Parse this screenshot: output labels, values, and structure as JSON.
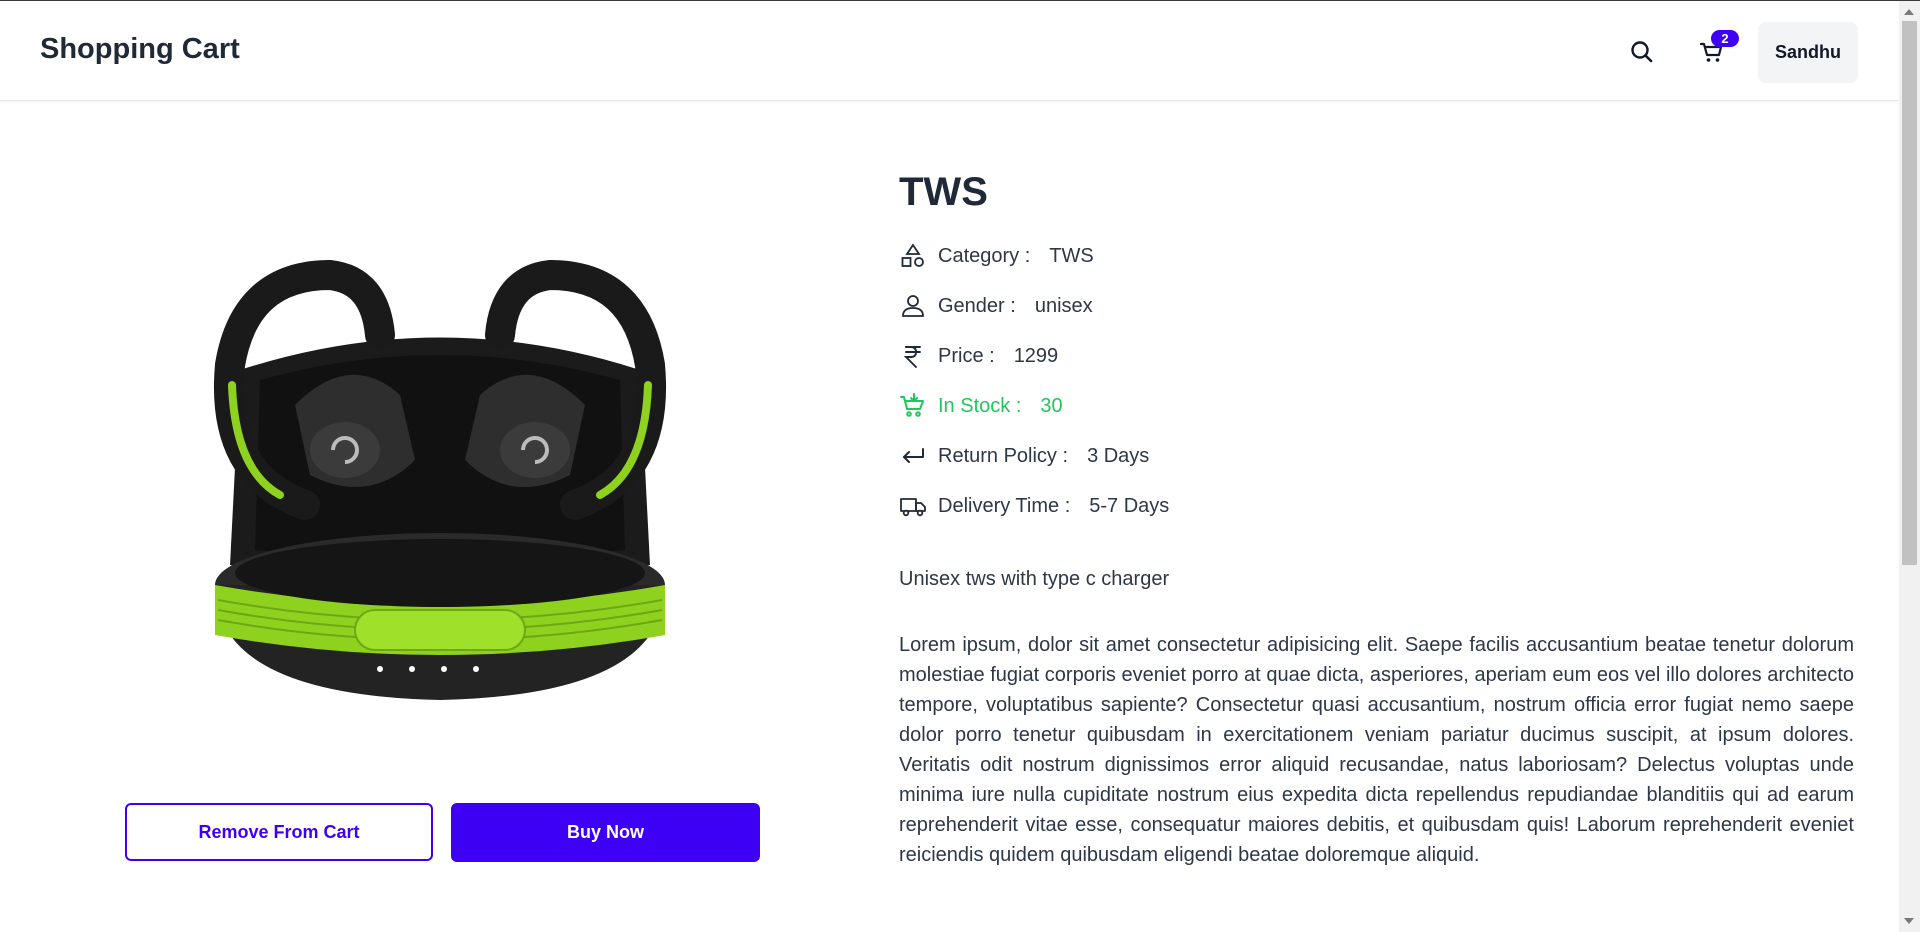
{
  "header": {
    "brand": "Shopping Cart",
    "cart_count": "2",
    "user_name": "Sandhu"
  },
  "product": {
    "name": "TWS",
    "image_icon": "wireless-earbuds-product-image",
    "specs": [
      {
        "label": "Category :",
        "value": "TWS",
        "icon": "shapes-icon"
      },
      {
        "label": "Gender :",
        "value": "unisex",
        "icon": "person-icon"
      },
      {
        "label": "Price :",
        "value": "1299",
        "icon": "rupee-icon"
      },
      {
        "label": "In Stock :",
        "value": "30",
        "icon": "cart-stock-icon"
      },
      {
        "label": "Return Policy :",
        "value": "3 Days",
        "icon": "return-arrow-icon"
      },
      {
        "label": "Delivery Time :",
        "value": "5-7 Days",
        "icon": "truck-icon"
      }
    ],
    "short_description": "Unisex tws with type c charger",
    "long_description": "Lorem ipsum, dolor sit amet consectetur adipisicing elit. Saepe facilis accusantium beatae tenetur dolorum molestiae fugiat corporis eveniet porro at quae dicta, asperiores, aperiam eum eos vel illo dolores architecto tempore, voluptatibus sapiente? Consectetur quasi accusantium, nostrum officia error fugiat nemo saepe dolor porro tenetur quibusdam in exercitationem veniam pariatur ducimus suscipit, at ipsum dolores. Veritatis odit nostrum dignissimos error aliquid recusandae, natus laboriosam? Delectus voluptas unde minima iure nulla cupiditate nostrum eius expedita dicta repellendus repudiandae blanditiis qui ad earum reprehenderit vitae esse, consequatur maiores debitis, et quibusdam quis! Laborum reprehenderit eveniet reiciendis quidem quibusdam eligendi beatae doloremque aliquid."
  },
  "actions": {
    "remove_label": "Remove From Cart",
    "buy_label": "Buy Now"
  },
  "colors": {
    "accent": "#3d00f5",
    "in_stock": "#22c55e",
    "product_green": "#8fd11f"
  }
}
